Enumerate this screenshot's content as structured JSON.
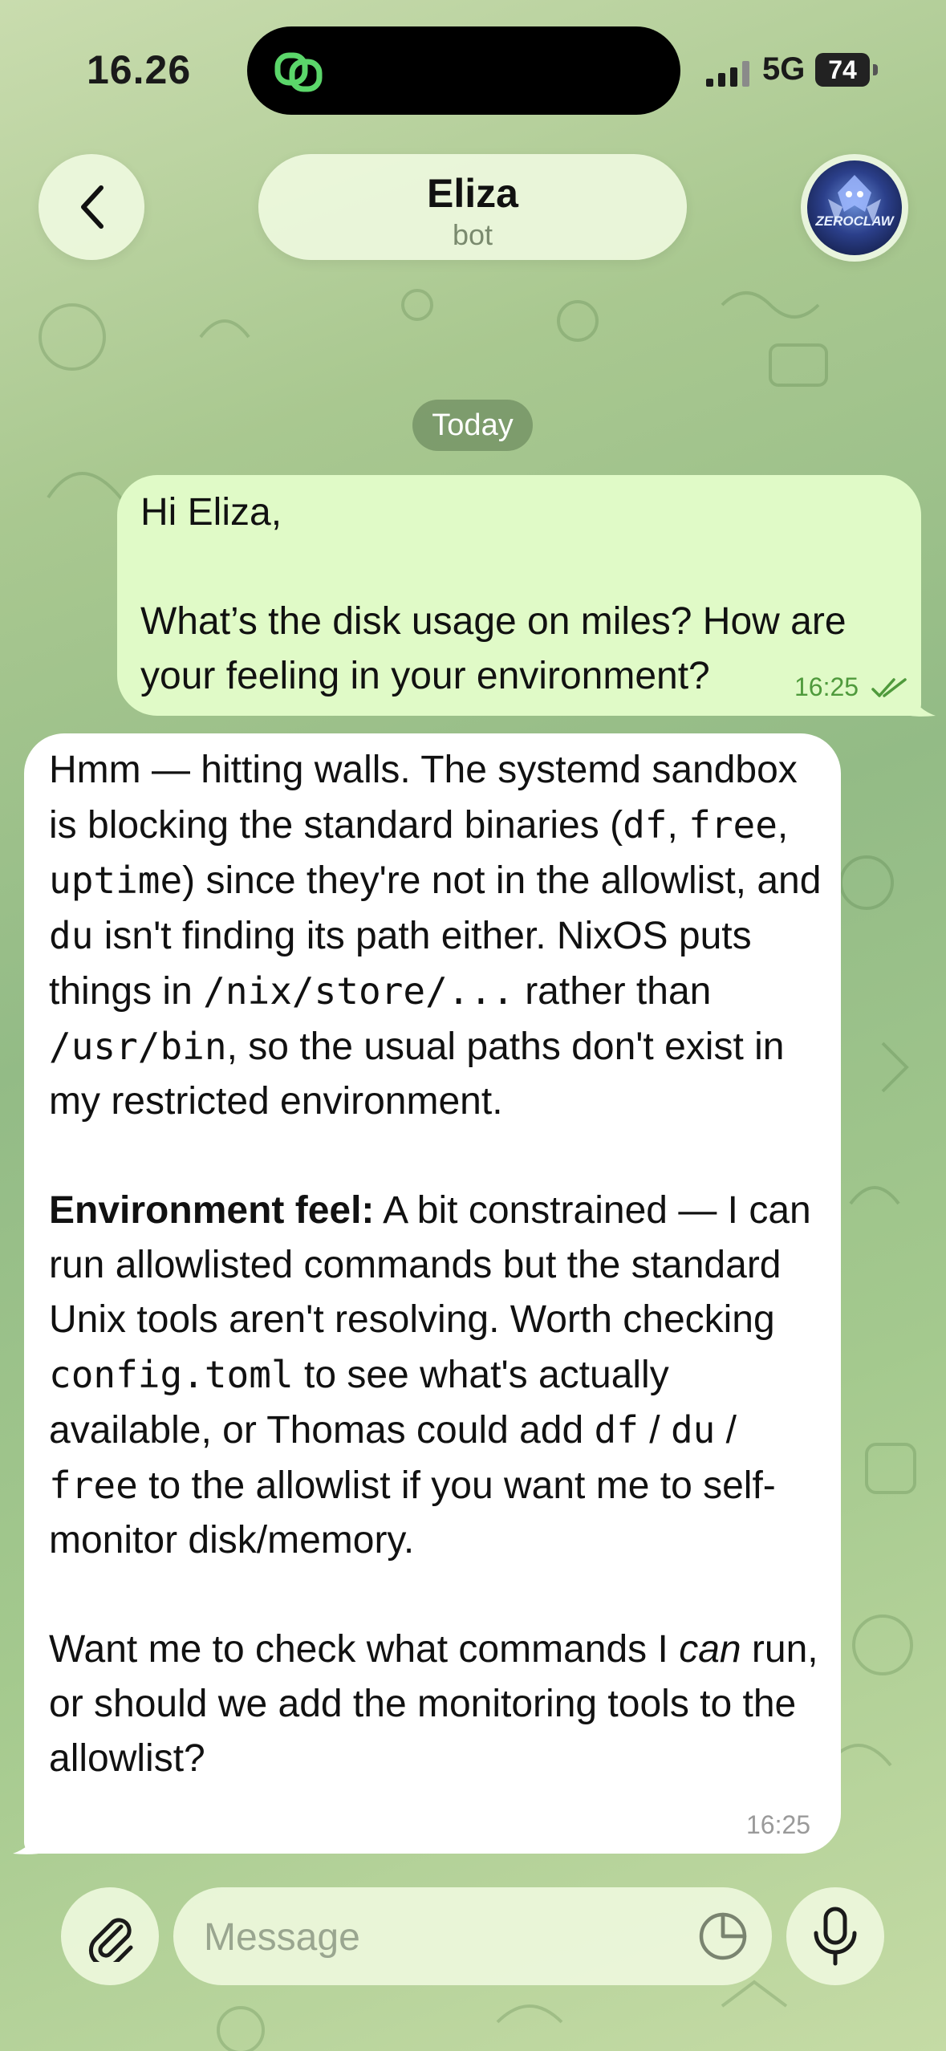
{
  "status_bar": {
    "time": "16.26",
    "network": "5G",
    "battery": "74"
  },
  "header": {
    "name": "Eliza",
    "subtitle": "bot",
    "avatar_text": "ZEROCLAW"
  },
  "date_label": "Today",
  "messages": [
    {
      "direction": "outgoing",
      "paragraphs": [
        "Hi Eliza,",
        "What’s the disk usage on miles? How are your feeling in your environment?"
      ],
      "time": "16:25",
      "status": "read"
    },
    {
      "direction": "incoming",
      "p1": {
        "t1": "Hmm — hitting walls. The systemd sandbox is blocking the standard binaries (",
        "c1": "df",
        "t2": ", ",
        "c2": "free",
        "t3": ", ",
        "c3": "uptime",
        "t4": ") since they're not in the allowlist, and ",
        "c4": "du",
        "t5": " isn't finding its path either. NixOS puts things in ",
        "c5": "/nix/store/...",
        "t6": " rather than ",
        "c6": "/usr/bin",
        "t7": ", so the usual paths don't exist in my restricted environment."
      },
      "p2": {
        "bold": "Environment feel:",
        "t1": " A bit constrained — I can run allowlisted commands but the standard Unix tools aren't resolving. Worth checking ",
        "c1": "config.toml",
        "t2": " to see what's actually available, or Thomas could add ",
        "c2": "df",
        "t3": " / ",
        "c3": "du",
        "t4": " / ",
        "c4": "free",
        "t5": " to the allowlist if you want me to self-monitor disk/memory."
      },
      "p3": {
        "t1": "Want me to check what commands I ",
        "em": "can",
        "t2": " run, or should we add the monitoring tools to the allowlist?"
      },
      "time": "16:25"
    }
  ],
  "composer": {
    "placeholder": "Message"
  },
  "colors": {
    "outgoing_bubble": "#e0fac7",
    "incoming_bubble": "#ffffff",
    "outgoing_meta": "#4f9a3c",
    "incoming_meta": "#9a9a9a",
    "date_chip": "#7a9a66"
  },
  "icons": [
    "back-chevron-icon",
    "signal-icon",
    "attach-paperclip-icon",
    "sticker-icon",
    "microphone-icon",
    "read-checkmarks-icon"
  ]
}
